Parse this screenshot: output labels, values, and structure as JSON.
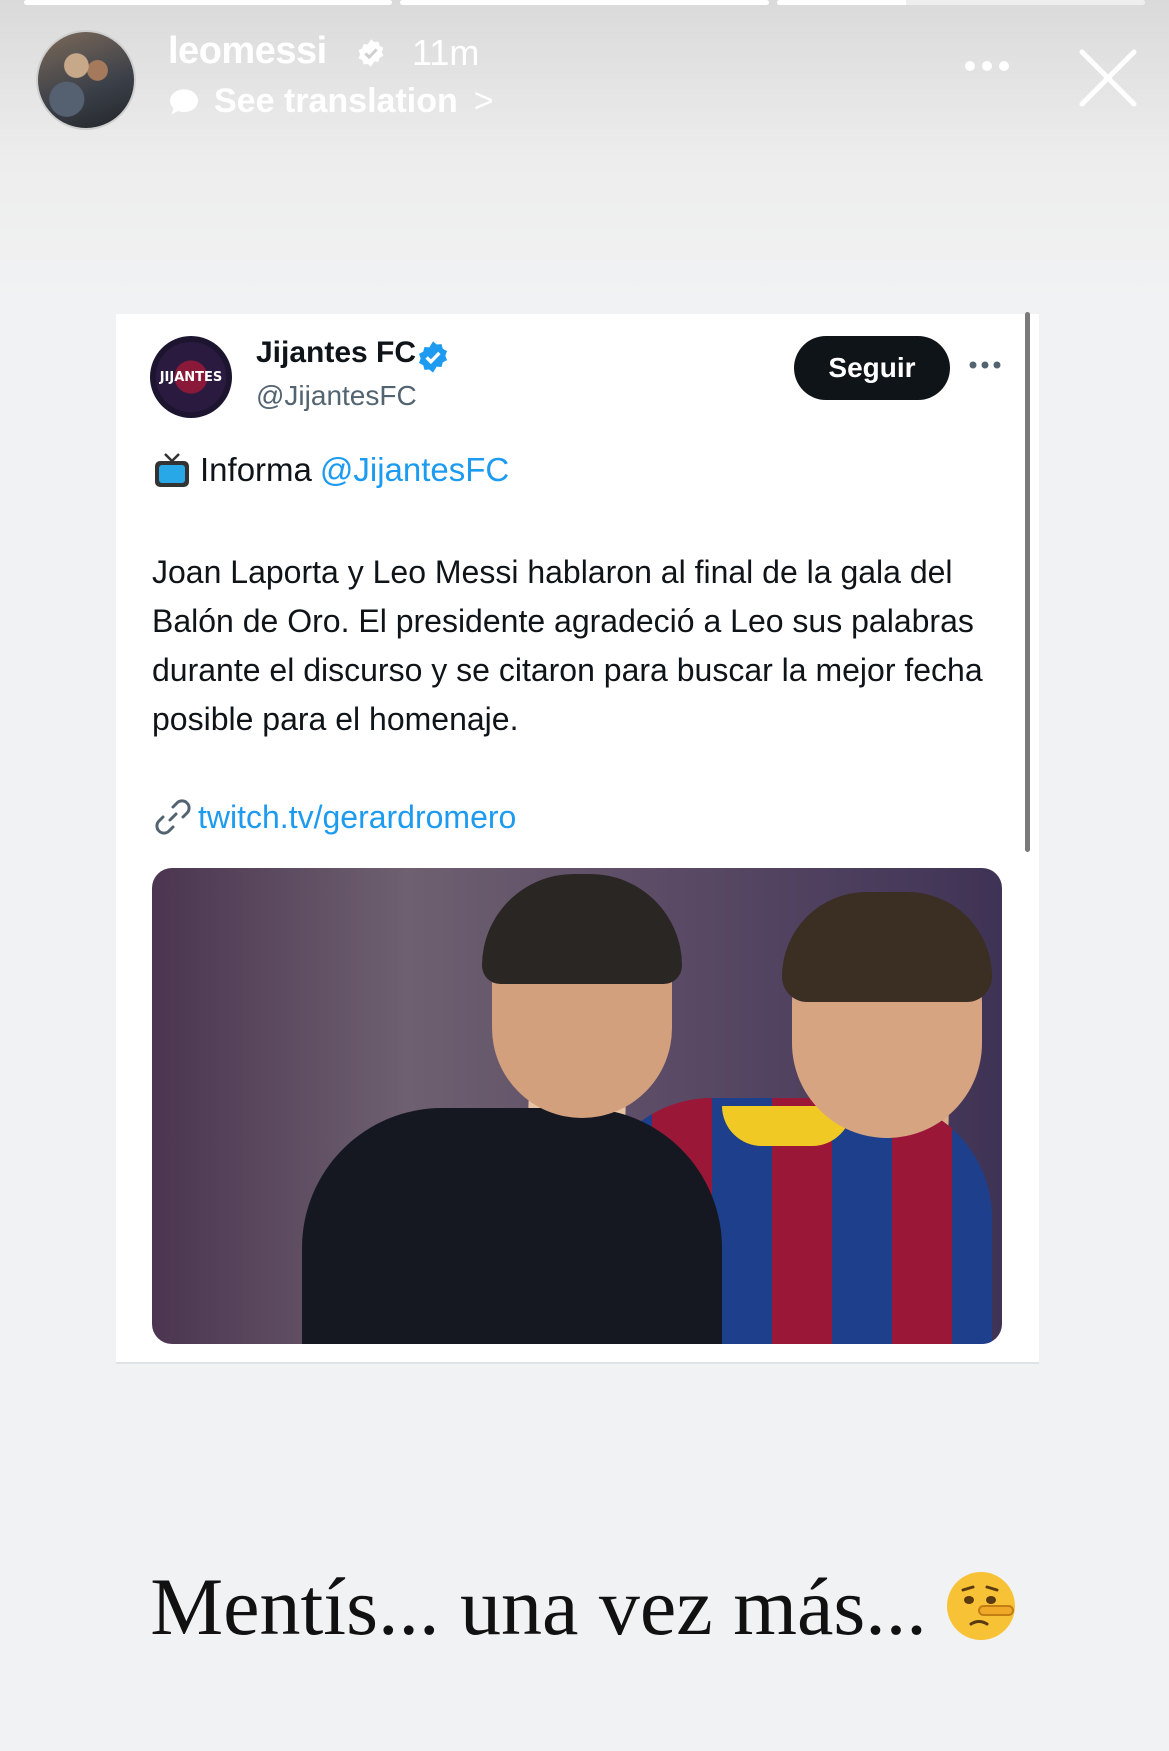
{
  "story": {
    "progress_segments": [
      1,
      1,
      0.35
    ],
    "username": "leomessi",
    "time_ago": "11m",
    "translation_label": "See translation",
    "translation_chevron": ">"
  },
  "tweet": {
    "display_name": "Jijantes FC",
    "handle": "@JijantesFC",
    "avatar_text": "JIJANTES",
    "follow_label": "Seguir",
    "info_prefix": "Informa",
    "info_mention": "@JijantesFC",
    "body": "Joan Laporta y Leo Messi hablaron al final de la gala del Balón de Oro. El presidente agradeció a Leo sus palabras  durante el discurso y se citaron para buscar la mejor fecha posible para el homenaje.",
    "link_text": "twitch.tv/gerardromero"
  },
  "caption": {
    "text": "Mentís... una vez más..."
  },
  "colors": {
    "accent": "#1d9bf0",
    "button_dark": "#0f1419",
    "story_text": "#ffffff"
  },
  "icons": [
    "verified-badge-icon",
    "speech-bubble-icon",
    "more-dots-icon",
    "close-icon",
    "tv-icon",
    "link-icon",
    "lying-face-emoji-icon"
  ]
}
